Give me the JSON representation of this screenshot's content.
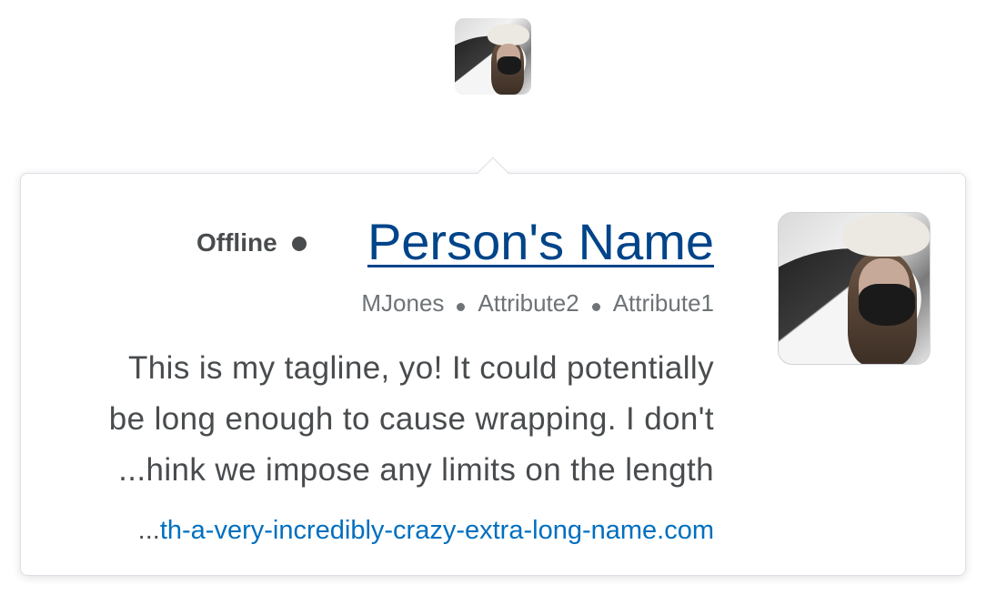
{
  "header": {
    "avatar_icon": "user-photo"
  },
  "card": {
    "status": "Offline",
    "status_color": "#494c4e",
    "name": "Person's Name",
    "name_color": "#004489",
    "attributes": [
      "MJones",
      "Attribute2",
      "Attribute1"
    ],
    "tagline_lines": [
      "This is my tagline, yo! It could potentially",
      "be long enough to cause wrapping. I don't",
      "...hink we impose any limits on the length"
    ],
    "website": {
      "ellipsis": "...",
      "text": "th-a-very-incredibly-crazy-extra-long-name.com",
      "color": "#006fbf"
    },
    "avatar_icon": "user-photo"
  }
}
